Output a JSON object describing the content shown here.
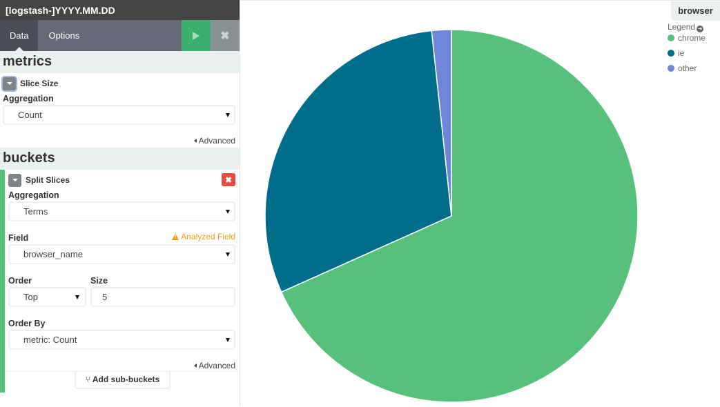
{
  "sidebar": {
    "index_pattern": "[logstash-]YYYY.MM.DD",
    "tabs": [
      {
        "label": "Data",
        "active": true
      },
      {
        "label": "Options",
        "active": false
      }
    ],
    "run_icon": "play-icon",
    "discard_icon": "close-icon",
    "metrics": {
      "heading": "metrics",
      "agg_title": "Slice Size",
      "aggregation_label": "Aggregation",
      "aggregation_value": "Count",
      "advanced_label": "Advanced"
    },
    "buckets": {
      "heading": "buckets",
      "agg_title": "Split Slices",
      "aggregation_label": "Aggregation",
      "aggregation_value": "Terms",
      "field_label": "Field",
      "field_warning": "Analyzed Field",
      "field_value": "browser_name",
      "order_label": "Order",
      "order_value": "Top",
      "size_label": "Size",
      "size_value": "5",
      "order_by_label": "Order By",
      "order_by_value": "metric: Count",
      "advanced_label": "Advanced",
      "delete_icon": "close-icon"
    },
    "add_sub_buckets_label": "Add sub-buckets",
    "add_sub_buckets_icon": "branch-icon"
  },
  "chart_data": {
    "type": "pie",
    "title": "browser",
    "legend_title": "Legend",
    "legend_position": "top-right",
    "categories": [
      "chrome",
      "ie",
      "other"
    ],
    "values": [
      68.3,
      30.0,
      1.7
    ],
    "unit": "percent of count (estimated)",
    "colors": [
      "#57c17b",
      "#006e8a",
      "#6f87d8"
    ]
  }
}
